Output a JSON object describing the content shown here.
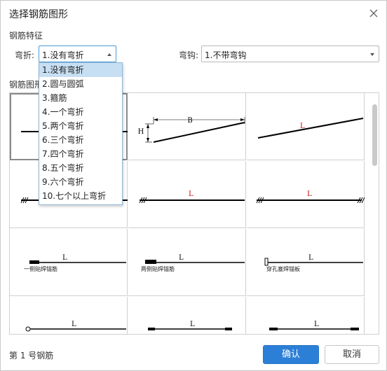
{
  "dialog": {
    "title": "选择钢筋图形",
    "close_label": "×"
  },
  "feature": {
    "section_label": "钢筋特征",
    "bend_label": "弯折:",
    "bend_value": "1.没有弯折",
    "hook_label": "弯钩:",
    "hook_value": "1.不带弯钩"
  },
  "shapes": {
    "section_label": "钢筋图形"
  },
  "dropdown": {
    "items": [
      "1.没有弯折",
      "2.圆与圆弧",
      "3.箍筋",
      "4.一个弯折",
      "5.两个弯折",
      "6.三个弯折",
      "7.四个弯折",
      "8.五个弯折",
      "9.六个弯折",
      "10.七个以上弯折"
    ],
    "selected_index": 0
  },
  "cells": {
    "c2": {
      "dim_b": "B",
      "dim_h": "H"
    },
    "c3": {
      "dim_l": "L"
    },
    "c5": {
      "dim_l": "L"
    },
    "c6": {
      "dim_l": "L"
    },
    "c7": {
      "dim_l": "L",
      "caption": "一侧贴焊锚筋"
    },
    "c8": {
      "dim_l": "L",
      "caption": "两侧贴焊锚筋"
    },
    "c9": {
      "dim_l": "L",
      "caption": "穿孔塞焊锚板"
    },
    "c10": {
      "dim_l": "L"
    },
    "c11": {
      "dim_l": "L"
    },
    "c12": {
      "dim_l": "L"
    }
  },
  "footer": {
    "status": "第 1 号钢筋",
    "ok_label": "确认",
    "cancel_label": "取消"
  },
  "colors": {
    "primary": "#2c7fd6",
    "selected_item": "#c7dff3",
    "dimension_red": "#cc0000"
  }
}
